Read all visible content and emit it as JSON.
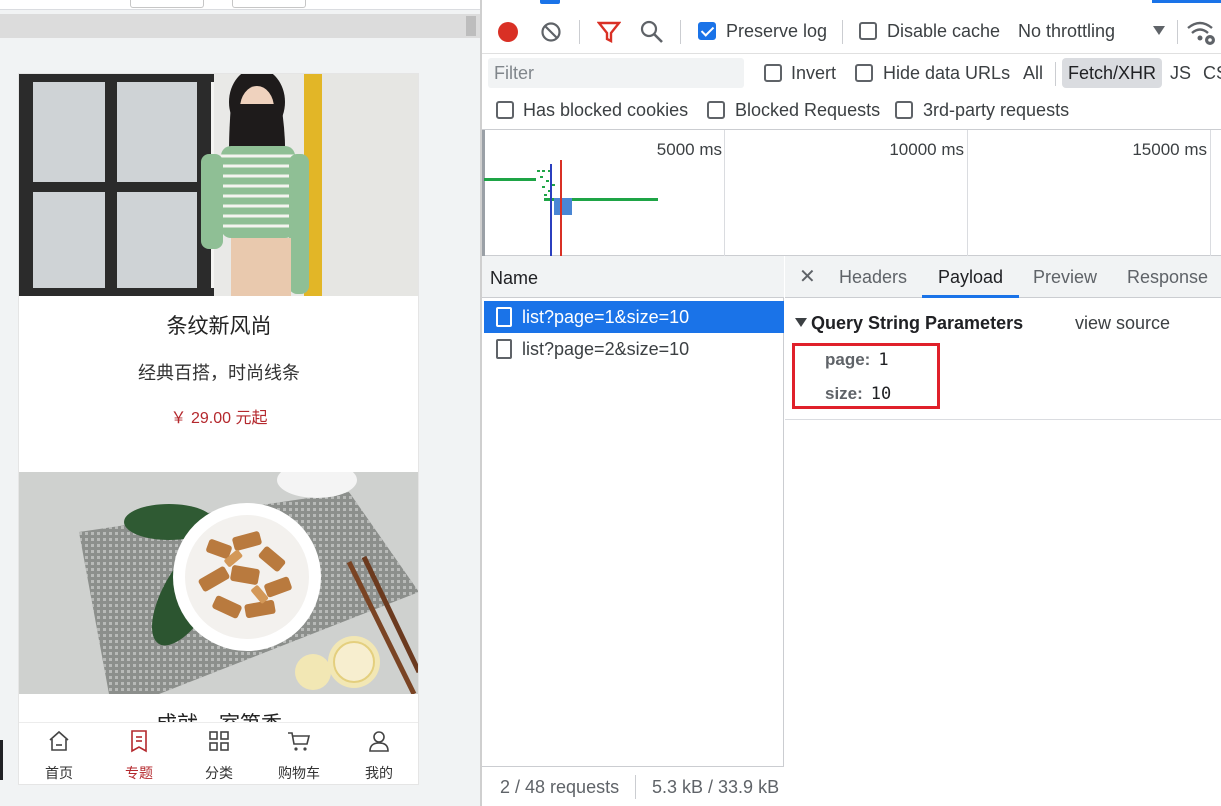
{
  "preview": {
    "card1": {
      "title": "条纹新风尚",
      "subtitle": "经典百搭，时尚线条",
      "price": "￥ 29.00 元起"
    },
    "card2": {
      "title": "成就一室笋香"
    },
    "tabbar": [
      {
        "label": "首页",
        "icon": "home-icon",
        "active": false
      },
      {
        "label": "专题",
        "icon": "topic-icon",
        "active": true
      },
      {
        "label": "分类",
        "icon": "category-icon",
        "active": false
      },
      {
        "label": "购物车",
        "icon": "cart-icon",
        "active": false
      },
      {
        "label": "我的",
        "icon": "user-icon",
        "active": false
      }
    ],
    "accent_color": "#b4282d"
  },
  "devtools": {
    "toolbar": {
      "preserve_log_label": "Preserve log",
      "preserve_log_checked": true,
      "disable_cache_label": "Disable cache",
      "disable_cache_checked": false,
      "throttling_value": "No throttling",
      "record_color": "#d93025"
    },
    "filter": {
      "placeholder": "Filter",
      "invert_label": "Invert",
      "hide_data_urls_label": "Hide data URLs",
      "types": [
        "All",
        "Fetch/XHR",
        "JS",
        "CS"
      ],
      "active_type": "Fetch/XHR"
    },
    "blocked": {
      "has_blocked_cookies_label": "Has blocked cookies",
      "blocked_requests_label": "Blocked Requests",
      "third_party_label": "3rd-party requests"
    },
    "overview": {
      "ticks": [
        "5000 ms",
        "10000 ms",
        "15000 ms"
      ]
    },
    "requests": {
      "header": "Name",
      "items": [
        {
          "name": "list?page=1&size=10",
          "selected": true
        },
        {
          "name": "list?page=2&size=10",
          "selected": false
        }
      ],
      "footer_count": "2 / 48 requests",
      "footer_size": "5.3 kB / 33.9 kB"
    },
    "detail": {
      "tabs": [
        "Headers",
        "Payload",
        "Preview",
        "Response"
      ],
      "active_tab": "Payload",
      "section_title": "Query String Parameters",
      "view_source_label": "view source",
      "params": [
        {
          "key": "page:",
          "value": "1"
        },
        {
          "key": "size:",
          "value": "10"
        }
      ]
    },
    "accent_color": "#1a73e8"
  }
}
